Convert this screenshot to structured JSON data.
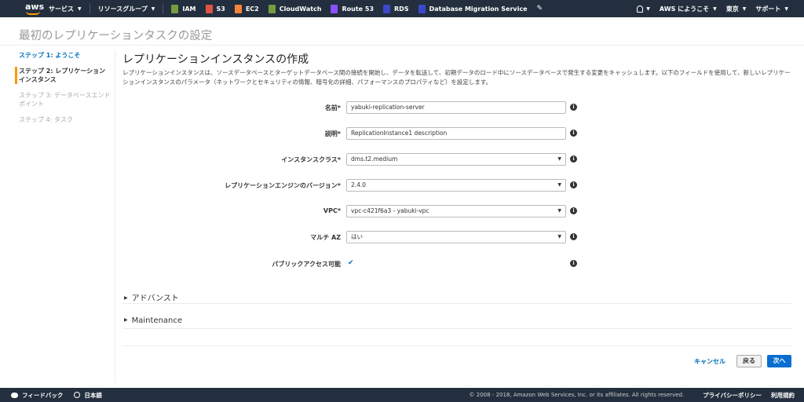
{
  "nav": {
    "services": "サービス",
    "resource_groups": "リソースグループ",
    "shortcuts": [
      {
        "label": "IAM",
        "icon": "iam-icon",
        "color": "#759c3e"
      },
      {
        "label": "S3",
        "icon": "s3-icon",
        "color": "#e05243"
      },
      {
        "label": "EC2",
        "icon": "ec2-icon",
        "color": "#f58536"
      },
      {
        "label": "CloudWatch",
        "icon": "cloudwatch-icon",
        "color": "#759c3e"
      },
      {
        "label": "Route 53",
        "icon": "route53-icon",
        "color": "#8c4fff"
      },
      {
        "label": "RDS",
        "icon": "rds-icon",
        "color": "#3b48cc"
      },
      {
        "label": "Database Migration Service",
        "icon": "dms-icon",
        "color": "#3b48cc"
      }
    ],
    "account": "AWS にようこそ",
    "region": "東京",
    "support": "サポート"
  },
  "page_title": "最初のレプリケーションタスクの設定",
  "steps": [
    {
      "label": "ステップ 1: ようこそ",
      "state": "done"
    },
    {
      "label": "ステップ 2: レプリケーションインスタンス",
      "state": "current"
    },
    {
      "label": "ステップ 3: データベースエンドポイント",
      "state": "future"
    },
    {
      "label": "ステップ 4: タスク",
      "state": "future"
    }
  ],
  "section": {
    "title": "レプリケーションインスタンスの作成",
    "description": "レプリケーションインスタンスは、ソースデータベースとターゲットデータベース間の接続を開始し、データを転送して、初期データのロード中にソースデータベースで発生する変更をキャッシュします。以下のフィールドを使用して、新しいレプリケーションインスタンスのパラメータ（ネットワークとセキュリティの情報、暗号化の詳細、パフォーマンスのプロパティなど）を設定します。"
  },
  "form": {
    "name": {
      "label": "名前*",
      "value": "yabuki-replication-server"
    },
    "description": {
      "label": "説明*",
      "value": "ReplicationInstance1 description"
    },
    "instance_class": {
      "label": "インスタンスクラス*",
      "value": "dms.t2.medium"
    },
    "engine_version": {
      "label": "レプリケーションエンジンのバージョン*",
      "value": "2.4.0"
    },
    "vpc": {
      "label": "VPC*",
      "value": "vpc-c421f6a3 - yabuki-vpc"
    },
    "multi_az": {
      "label": "マルチ AZ",
      "value": "はい"
    },
    "public_access": {
      "label": "パブリックアクセス可能",
      "checked": true
    }
  },
  "expanders": {
    "advanced": "アドバンスト",
    "maintenance": "Maintenance"
  },
  "buttons": {
    "cancel": "キャンセル",
    "back": "戻る",
    "next": "次へ"
  },
  "footer": {
    "feedback": "フィードバック",
    "language": "日本語",
    "copyright": "© 2008 - 2018, Amazon Web Services, Inc. or its affiliates. All rights reserved.",
    "privacy": "プライバシーポリシー",
    "terms": "利用規約"
  }
}
